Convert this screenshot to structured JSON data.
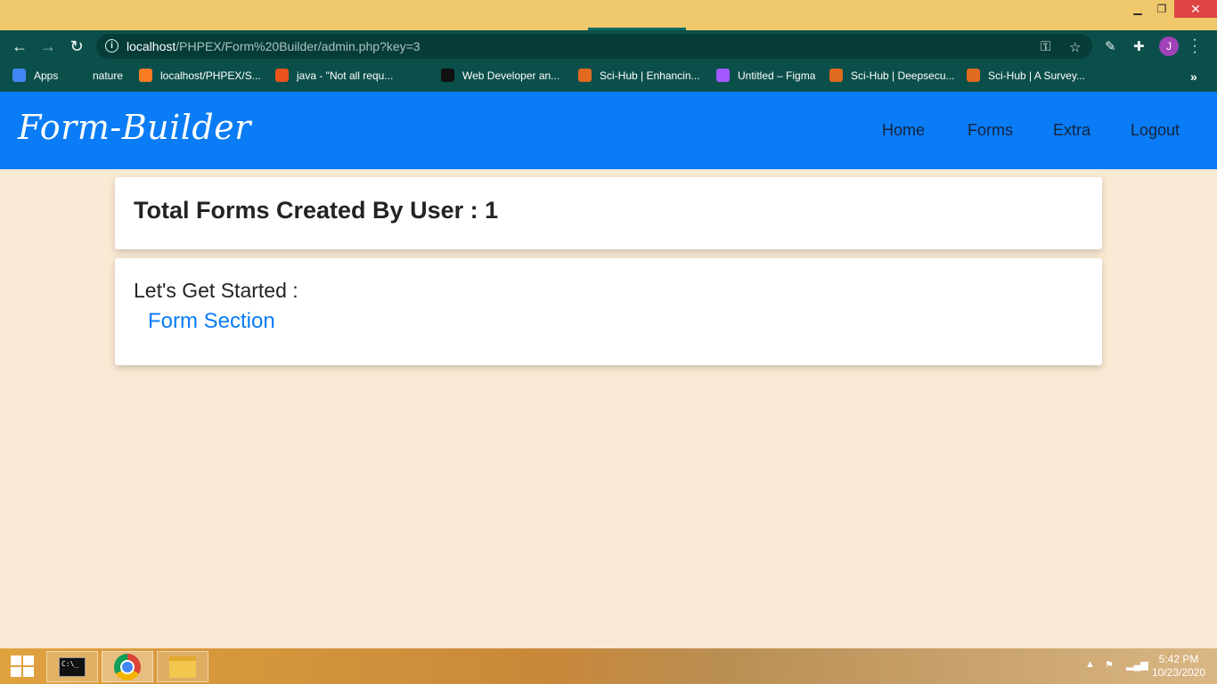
{
  "window": {
    "minimize_glyph": "▁",
    "maximize_glyph": "❐",
    "close_glyph": "✕"
  },
  "browser": {
    "url_host": "localhost",
    "url_path": "/PHPEX/Form%20Builder/admin.php?key=3",
    "profile_initial": "J",
    "bookmarks": [
      {
        "label": "Apps",
        "icon": "apps-grid-icon",
        "color": "#4285f4"
      },
      {
        "label": "nature",
        "icon": "globe-icon",
        "color": "#0b4f4a"
      },
      {
        "label": "localhost/PHPEX/S...",
        "icon": "xampp-icon",
        "color": "#fb7a24"
      },
      {
        "label": "java - \"Not all requ...",
        "icon": "ask-icon",
        "color": "#e8541c"
      },
      {
        "label": "",
        "icon": "globe-icon",
        "color": "#0b4f4a"
      },
      {
        "label": "Web Developer an...",
        "icon": "roadmap-icon",
        "color": "#111111"
      },
      {
        "label": "Sci-Hub | Enhancin...",
        "icon": "scihub-icon",
        "color": "#e06a1f"
      },
      {
        "label": "Untitled – Figma",
        "icon": "figma-icon",
        "color": "#a259ff"
      },
      {
        "label": "Sci-Hub | Deepsecu...",
        "icon": "scihub-icon",
        "color": "#e06a1f"
      },
      {
        "label": "Sci-Hub | A Survey...",
        "icon": "scihub-icon",
        "color": "#e06a1f"
      }
    ],
    "more_glyph": "»"
  },
  "site": {
    "brand": "Form-Builder",
    "nav": [
      "Home",
      "Forms",
      "Extra",
      "Logout"
    ],
    "nav_color": "#0a7cf6"
  },
  "main": {
    "total_heading": "Total Forms Created By User : 1",
    "started_label": "Let's Get Started :",
    "form_link": "Form Section"
  },
  "taskbar": {
    "time": "5:42 PM",
    "date": "10/23/2020",
    "cmd_text": "C:\\_"
  }
}
